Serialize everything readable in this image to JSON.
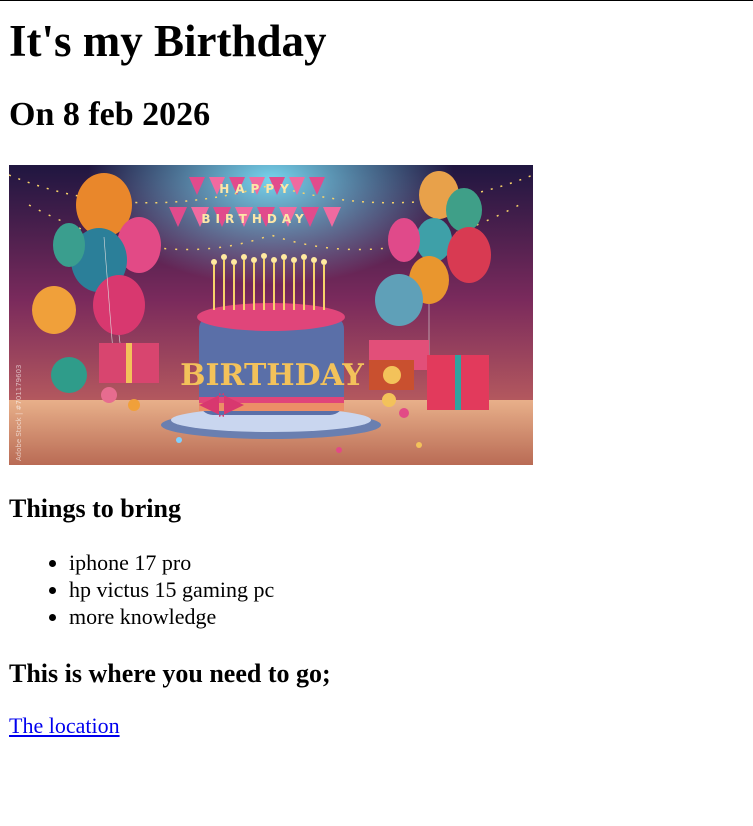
{
  "page": {
    "title": "It's my Birthday",
    "date_heading": "On 8 feb 2026"
  },
  "image": {
    "banner_line1": "HAPPY",
    "banner_line2": "BIRTHDAY",
    "cake_text": "BIRTHDAY",
    "watermark": "Adobe Stock | #701179603",
    "colors": {
      "bg_top": "#2a1a4a",
      "bg_mid": "#8a2d5a",
      "bg_bottom": "#d66a5a",
      "cake": "#5a6fa8",
      "frosting": "#e0457a",
      "gold": "#f3c25a"
    }
  },
  "bring": {
    "heading": "Things to bring",
    "items": [
      "iphone 17 pro",
      "hp victus 15 gaming pc",
      "more knowledge"
    ]
  },
  "location": {
    "heading": "This is where you need to go;",
    "link_text": "The location"
  }
}
